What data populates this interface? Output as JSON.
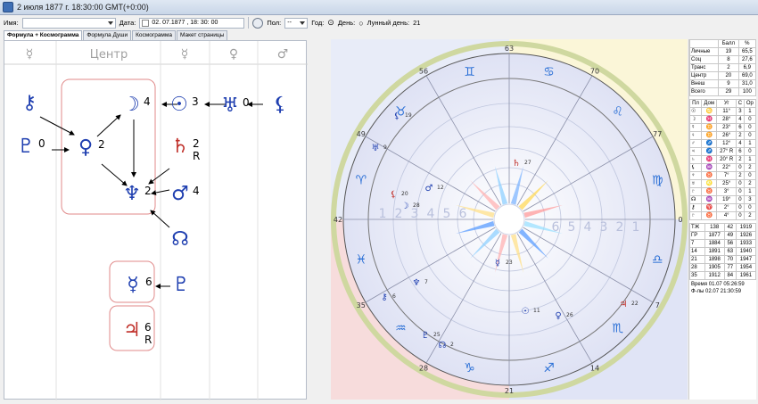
{
  "window": {
    "title": "2 июля 1877 г. 18:30:00 GMT(+0:00)"
  },
  "toolbar": {
    "name_label": "Имя:",
    "name_value": "",
    "date_label": "Дата:",
    "date_value": "02. 07.1877 , 18: 30: 00",
    "sex_label": "Пол:",
    "sex_value": "--",
    "year_label": "Год:",
    "day_label": "День:",
    "lunar_day_label": "Лунный день:",
    "lunar_day_value": "21"
  },
  "tabs": [
    "Формула + Космограмма",
    "Формула Души",
    "Космограмма",
    "Макет страницы"
  ],
  "formula": {
    "header_center": "Центр",
    "header_symbols": [
      "☿",
      "☿",
      "♀",
      "♂"
    ],
    "planets": [
      {
        "id": "chiron",
        "glyph": "⚷",
        "num": "",
        "color": "#1f3fb0"
      },
      {
        "id": "pluto",
        "glyph": "♇",
        "num": "0",
        "color": "#1f3fb0"
      },
      {
        "id": "venus",
        "glyph": "♀",
        "num": "2",
        "color": "#1f3fb0"
      },
      {
        "id": "moon",
        "glyph": "☽",
        "num": "4",
        "color": "#1f3fb0"
      },
      {
        "id": "sun",
        "glyph": "☉",
        "num": "3",
        "color": "#1f3fb0"
      },
      {
        "id": "uranus",
        "glyph": "♅",
        "num": "0",
        "color": "#1f3fb0"
      },
      {
        "id": "lilith",
        "glyph": "⚸",
        "num": "",
        "color": "#1f3fb0"
      },
      {
        "id": "saturn",
        "glyph": "♄",
        "num": "2",
        "retro": "R",
        "color": "#c0302a"
      },
      {
        "id": "neptune",
        "glyph": "♆",
        "num": "2",
        "color": "#1f3fb0"
      },
      {
        "id": "mars",
        "glyph": "♂",
        "num": "4",
        "color": "#1f3fb0"
      },
      {
        "id": "node",
        "glyph": "☊",
        "num": "",
        "color": "#1f3fb0"
      },
      {
        "id": "mercury",
        "glyph": "☿",
        "num": "6",
        "color": "#1f3fb0"
      },
      {
        "id": "proserpina",
        "glyph": "♇",
        "num": "",
        "color": "#1f3fb0"
      },
      {
        "id": "jupiter",
        "glyph": "♃",
        "num": "6",
        "retro": "R",
        "color": "#c0302a"
      }
    ]
  },
  "cosmogram": {
    "zodiac_icons": [
      "aries-icon",
      "taurus-icon",
      "gemini-icon",
      "cancer-icon",
      "leo-icon",
      "virgo-icon",
      "libra-icon",
      "scorpio-icon",
      "sagittarius-icon",
      "capricorn-icon",
      "aquarius-icon",
      "pisces-icon"
    ],
    "zodiac_glyphs": [
      "♈",
      "♉",
      "♊",
      "♋",
      "♌",
      "♍",
      "♎",
      "♏",
      "♐",
      "♑",
      "♒",
      "♓"
    ],
    "ring_numbers": [
      "63",
      "70",
      "77",
      "0",
      "7",
      "14",
      "21",
      "28",
      "35",
      "42",
      "49",
      "56"
    ],
    "inner_scale": [
      "6",
      "5",
      "4",
      "3",
      "2",
      "1"
    ],
    "chart_planets": [
      {
        "glyph": "♄",
        "label": "27",
        "color": "#c0302a"
      },
      {
        "glyph": "♂",
        "label": "12",
        "color": "#1f3fb0"
      },
      {
        "glyph": "☽",
        "label": "28",
        "color": "#1f3fb0"
      },
      {
        "glyph": "⚸",
        "label": "20",
        "color": "#c0302a"
      },
      {
        "glyph": "♅",
        "label": "9",
        "color": "#1f3fb0"
      },
      {
        "glyph": "⚸",
        "label": "19",
        "color": "#1f3fb0"
      },
      {
        "glyph": "♆",
        "label": "7",
        "color": "#1f3fb0"
      },
      {
        "glyph": "⚷",
        "label": "6",
        "color": "#1f3fb0"
      },
      {
        "glyph": "♇",
        "label": "25",
        "color": "#1f3fb0"
      },
      {
        "glyph": "☊",
        "label": "2",
        "color": "#1f3fb0"
      },
      {
        "glyph": "☿",
        "label": "23",
        "color": "#1f3fb0"
      },
      {
        "glyph": "☉",
        "label": "11",
        "color": "#1f3fb0"
      },
      {
        "glyph": "♀",
        "label": "26",
        "color": "#1f3fb0"
      },
      {
        "glyph": "♃",
        "label": "22",
        "color": "#c0302a"
      }
    ]
  },
  "stats": {
    "header": [
      "",
      "Балл",
      "%"
    ],
    "rows": [
      [
        "Личные",
        "19",
        "65,5"
      ],
      [
        "Соц",
        "8",
        "27,6"
      ],
      [
        "Транс",
        "2",
        "6,9"
      ],
      [
        "Центр",
        "20",
        "69,0"
      ],
      [
        "Внеш",
        "9",
        "31,0"
      ],
      [
        "Всего",
        "29",
        "100"
      ]
    ]
  },
  "planet_table": {
    "header": [
      "Пл",
      "Дом",
      "Уг",
      "С",
      "Ор"
    ],
    "rows": [
      [
        "☉",
        "♋",
        "11°",
        "3",
        "1"
      ],
      [
        "☽",
        "♓",
        "28°",
        "4",
        "0"
      ],
      [
        "☿",
        "♊",
        "23°",
        "6",
        "0"
      ],
      [
        "♀",
        "♊",
        "26°",
        "2",
        "0"
      ],
      [
        "♂",
        "♐",
        "12°",
        "4",
        "1"
      ],
      [
        "♃",
        "♐",
        "27° R",
        "6",
        "0"
      ],
      [
        "♄",
        "♓",
        "20° R",
        "2",
        "1"
      ],
      [
        "⚸",
        "♒",
        "22°",
        "0",
        "2"
      ],
      [
        "♆",
        "♉",
        "7°",
        "2",
        "0"
      ],
      [
        "♅",
        "♌",
        "25°",
        "0",
        "2"
      ],
      [
        "♇",
        "♉",
        "3°",
        "0",
        "1"
      ],
      [
        "☊",
        "♒",
        "19°",
        "0",
        "3"
      ],
      [
        "⚷",
        "♈",
        "2°",
        "0",
        "0"
      ],
      [
        "♇",
        "♉",
        "4°",
        "0",
        "2"
      ]
    ]
  },
  "years_table": {
    "rows": [
      [
        "ТЖ",
        "138",
        "42",
        "1919"
      ],
      [
        "ГР",
        "1877",
        "49",
        "1926"
      ],
      [
        "7",
        "1884",
        "56",
        "1933"
      ],
      [
        "14",
        "1891",
        "63",
        "1940"
      ],
      [
        "21",
        "1898",
        "70",
        "1947"
      ],
      [
        "28",
        "1905",
        "77",
        "1954"
      ],
      [
        "35",
        "1912",
        "84",
        "1961"
      ]
    ]
  },
  "footer": {
    "time_label": "Время",
    "time_value": "01.07 05:26:59",
    "form_label": "Ф-лы",
    "form_value": "02.07 21:30:59"
  }
}
